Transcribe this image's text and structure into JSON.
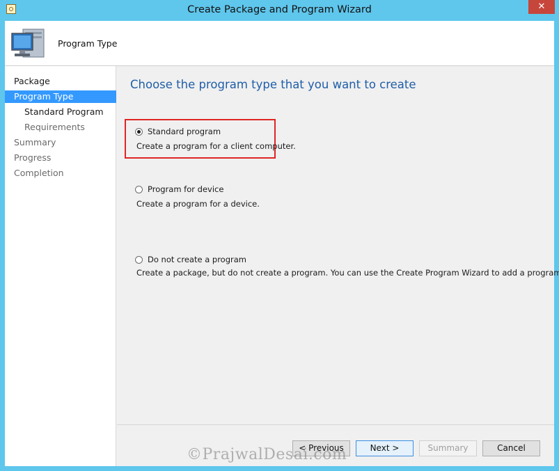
{
  "window": {
    "title": "Create Package and Program Wizard",
    "close_glyph": "✕",
    "title_icon": "wizard-app-icon"
  },
  "header": {
    "title": "Program Type",
    "icon": "computer-icon"
  },
  "sidebar": {
    "items": [
      {
        "label": "Package",
        "state": "normal"
      },
      {
        "label": "Program Type",
        "state": "active"
      },
      {
        "label": "Standard Program",
        "state": "normal"
      },
      {
        "label": "Requirements",
        "state": "dim"
      },
      {
        "label": "Summary",
        "state": "dim"
      },
      {
        "label": "Progress",
        "state": "dim"
      },
      {
        "label": "Completion",
        "state": "dim"
      }
    ]
  },
  "main": {
    "heading": "Choose the program type that you want to create",
    "options": [
      {
        "label": "Standard program",
        "description": "Create a program for a client computer.",
        "selected": true
      },
      {
        "label": "Program for device",
        "description": "Create a program for a device.",
        "selected": false
      },
      {
        "label": "Do not create a program",
        "description": "Create a package, but do not create a program. You can use the Create Program Wizard to add a program later.",
        "selected": false
      }
    ]
  },
  "buttons": {
    "previous": "< Previous",
    "next": "Next >",
    "summary": "Summary",
    "cancel": "Cancel"
  },
  "watermark": "©PrajwalDesai.com",
  "colors": {
    "accent": "#3399ff",
    "heading": "#1f5ea8",
    "highlight": "#e02424",
    "close": "#c7463b",
    "frame": "#5fc6ec"
  }
}
